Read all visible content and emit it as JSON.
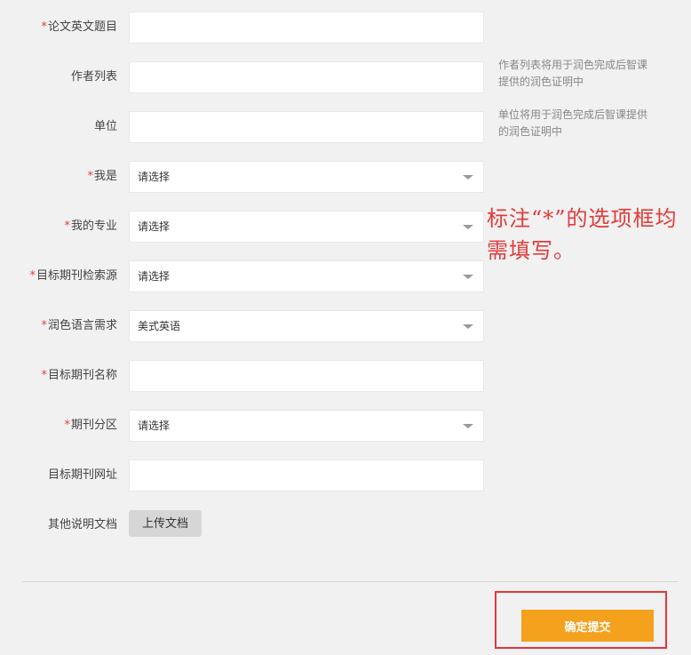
{
  "required_marker": "*",
  "fields": {
    "title_en": {
      "label": "论文英文题目",
      "value": ""
    },
    "authors": {
      "label": "作者列表",
      "value": "",
      "hint": "作者列表将用于润色完成后智课提供的润色证明中"
    },
    "unit": {
      "label": "单位",
      "value": "",
      "hint": "单位将用于润色完成后智课提供的润色证明中"
    },
    "identity": {
      "label": "我是",
      "value": "请选择"
    },
    "major": {
      "label": "我的专业",
      "value": "请选择"
    },
    "index_source": {
      "label": "目标期刊检索源",
      "value": "请选择"
    },
    "language": {
      "label": "润色语言需求",
      "value": "美式英语"
    },
    "journal_name": {
      "label": "目标期刊名称",
      "value": ""
    },
    "journal_zone": {
      "label": "期刊分区",
      "value": "请选择"
    },
    "journal_url": {
      "label": "目标期刊网址",
      "value": ""
    },
    "other_doc": {
      "label": "其他说明文档",
      "button": "上传文档"
    }
  },
  "annotation": "标注“*”的选项框均需填写。",
  "submit_label": "确定提交",
  "colors": {
    "required": "#e2413a",
    "submit": "#f4a11d",
    "annotation": "#e23b3b",
    "highlight_border": "#e5363b"
  }
}
